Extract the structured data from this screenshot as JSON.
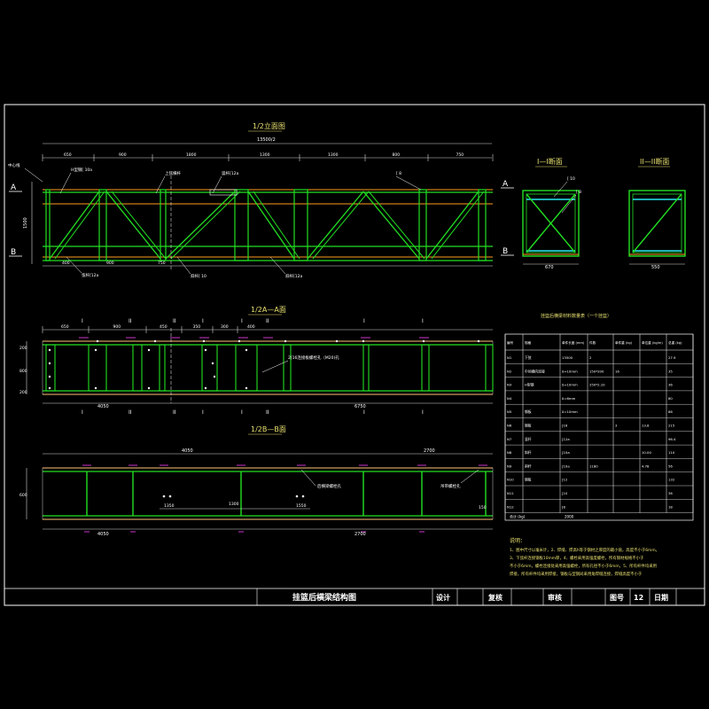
{
  "drawing": {
    "title": "挂篮后横梁结构图",
    "views": {
      "elevation_title": "1/2立面图",
      "section1_title": "I—I断面",
      "section2_title": "II—II断面",
      "planA_title": "1/2A—A面",
      "planB_title": "1/2B—B面"
    },
    "elevation": {
      "overall_dim": "13500/2",
      "segment_dims": [
        "650",
        "900",
        "1800",
        "1300",
        "1300",
        "800",
        "750"
      ],
      "left_dim": "1500",
      "bottom_dims": [
        "400",
        "900",
        "750"
      ],
      "section_marks": [
        "A",
        "B",
        "A",
        "B"
      ],
      "callouts": [
        "中心线",
        "H型钢[ 10a",
        "I-I",
        "II-II",
        "上弦横杆",
        "竖杆[12a",
        "[ 8",
        "弦杆[12a",
        "斜杆[ 10",
        "斜杆[12a"
      ]
    },
    "section_dims": [
      "670",
      "550"
    ],
    "section_labels": [
      "I-I",
      "II-II",
      "[ 10",
      "[ 8"
    ],
    "planA": {
      "marks": [
        "I",
        "II",
        "II",
        "I",
        "I",
        "II",
        "I",
        "I"
      ],
      "dims": [
        "650",
        "900",
        "450",
        "350",
        "300",
        "400",
        "4050",
        "6750"
      ],
      "side_dims": [
        "200",
        "800",
        "200"
      ],
      "callout": "2[16连接板螺栓孔（M20)孔"
    },
    "planB": {
      "dims": [
        "4050",
        "1350",
        "1300",
        "1550",
        "4050",
        "2700",
        "150"
      ],
      "side_dims": [
        "600"
      ],
      "callouts": [
        "后横梁螺栓孔",
        "吊带螺栓孔"
      ]
    },
    "table": {
      "title": "挂篮后横梁材料数量表（一个挂篮）",
      "headers": [
        "编号",
        "规格",
        "单件长度 (mm)",
        "件数",
        "单件重 (kg)",
        "单位重 (kg/m)",
        "总重 (kg)"
      ],
      "rows": [
        [
          "N1",
          "下弦",
          "13500",
          "2",
          "",
          "",
          "27.9"
        ],
        [
          "N2",
          "中间横向连接",
          "δ=10mm",
          "150*200",
          "16",
          "",
          "35"
        ],
        [
          "N3",
          "H型钢",
          "δ=10mm",
          "250*2.10",
          "",
          "",
          "36"
        ],
        [
          "N4",
          "",
          "δ=6mm",
          "",
          "",
          "",
          "80"
        ],
        [
          "N5",
          "钢板",
          "δ=10mm",
          "",
          "",
          "",
          "86"
        ],
        [
          "N6",
          "钢板",
          "[16",
          "",
          "3",
          "13.8",
          "215"
        ],
        [
          "N7",
          "竖杆",
          "[12a",
          "",
          "",
          "",
          "96.4"
        ],
        [
          "N8",
          "斜杆",
          "[10a",
          "",
          "",
          "10.00",
          "110"
        ],
        [
          "N9",
          "斜杆",
          "[10a",
          "1180",
          "",
          "4.78",
          "56"
        ],
        [
          "N10",
          "钢板",
          "[12",
          "",
          "",
          "",
          "132"
        ],
        [
          "N11",
          "",
          "[10",
          "",
          "",
          "",
          "36"
        ],
        [
          "N12",
          "",
          "[8",
          "",
          "",
          "",
          "18"
        ]
      ],
      "total_label": "合计 (kg)",
      "total_value": "2000"
    },
    "notes_title": "说明：",
    "notes": [
      "1、图中尺寸以毫米计，2、焊缝、焊高h等于钢材之厚度的最小值，高度不小于6mm。",
      "3、下弦杆连接钢板10mm厚，4、螺栓采用高强度螺栓，所有钢材规格不小于",
      "不小于6mm，螺栓连接处采用高强螺栓，所有孔径不小于6mm，5、所有杆件均采用",
      "焊接，所有杆件均采用焊接，钢板与型钢间采用角焊缝连接，焊缝高度不小于"
    ],
    "title_block": {
      "title": "挂篮后横梁结构图",
      "design_label": "设计",
      "review_label": "复核",
      "approve_label": "审核",
      "drawing_no_label": "图号",
      "drawing_no": "12",
      "date_label": "日期"
    }
  },
  "colors": {
    "background": "#000000",
    "steel_green": "#22e022",
    "chord_orange": "#ff9a1e",
    "annotation_white": "#ffffff",
    "marker_magenta": "#ff40ff",
    "section_cyan": "#29e8f0"
  }
}
